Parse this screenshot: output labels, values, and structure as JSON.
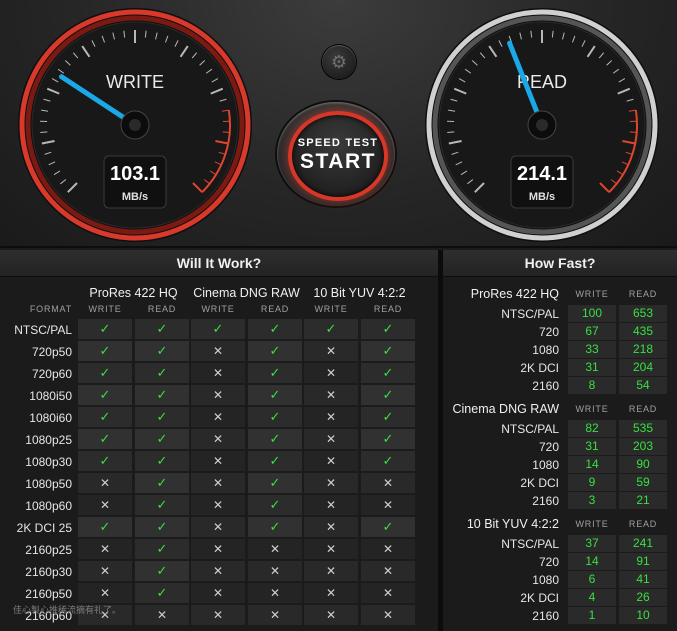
{
  "gauges": {
    "write": {
      "label": "WRITE",
      "value": "103.1",
      "unit": "MB/s",
      "needle_fraction": 0.29,
      "accent": "#d8392b"
    },
    "read": {
      "label": "READ",
      "value": "214.1",
      "unit": "MB/s",
      "needle_fraction": 0.42,
      "accent": "#c8c8c8"
    }
  },
  "settings_icon": "gear-icon",
  "start_button": {
    "line1": "SPEED TEST",
    "line2": "START"
  },
  "will_it_work": {
    "title": "Will It Work?",
    "format_label": "FORMAT",
    "groups": [
      {
        "name": "ProRes 422 HQ",
        "write": "WRITE",
        "read": "READ"
      },
      {
        "name": "Cinema DNG RAW",
        "write": "WRITE",
        "read": "READ"
      },
      {
        "name": "10 Bit YUV 4:2:2",
        "write": "WRITE",
        "read": "READ"
      }
    ],
    "rows": [
      {
        "format": "NTSC/PAL",
        "cells": [
          "✓",
          "✓",
          "✓",
          "✓",
          "✓",
          "✓"
        ]
      },
      {
        "format": "720p50",
        "cells": [
          "✓",
          "✓",
          "✕",
          "✓",
          "✕",
          "✓"
        ]
      },
      {
        "format": "720p60",
        "cells": [
          "✓",
          "✓",
          "✕",
          "✓",
          "✕",
          "✓"
        ]
      },
      {
        "format": "1080i50",
        "cells": [
          "✓",
          "✓",
          "✕",
          "✓",
          "✕",
          "✓"
        ]
      },
      {
        "format": "1080i60",
        "cells": [
          "✓",
          "✓",
          "✕",
          "✓",
          "✕",
          "✓"
        ]
      },
      {
        "format": "1080p25",
        "cells": [
          "✓",
          "✓",
          "✕",
          "✓",
          "✕",
          "✓"
        ]
      },
      {
        "format": "1080p30",
        "cells": [
          "✓",
          "✓",
          "✕",
          "✓",
          "✕",
          "✓"
        ]
      },
      {
        "format": "1080p50",
        "cells": [
          "✕",
          "✓",
          "✕",
          "✓",
          "✕",
          "✕"
        ]
      },
      {
        "format": "1080p60",
        "cells": [
          "✕",
          "✓",
          "✕",
          "✓",
          "✕",
          "✕"
        ]
      },
      {
        "format": "2K DCI 25",
        "cells": [
          "✓",
          "✓",
          "✕",
          "✓",
          "✕",
          "✓"
        ]
      },
      {
        "format": "2160p25",
        "cells": [
          "✕",
          "✓",
          "✕",
          "✕",
          "✕",
          "✕"
        ]
      },
      {
        "format": "2160p30",
        "cells": [
          "✕",
          "✓",
          "✕",
          "✕",
          "✕",
          "✕"
        ]
      },
      {
        "format": "2160p50",
        "cells": [
          "✕",
          "✓",
          "✕",
          "✕",
          "✕",
          "✕"
        ]
      },
      {
        "format": "2160p60",
        "cells": [
          "✕",
          "✕",
          "✕",
          "✕",
          "✕",
          "✕"
        ]
      }
    ]
  },
  "how_fast": {
    "title": "How Fast?",
    "sections": [
      {
        "name": "ProRes 422 HQ",
        "write": "WRITE",
        "read": "READ",
        "rows": [
          {
            "format": "NTSC/PAL",
            "write": "100",
            "read": "653"
          },
          {
            "format": "720",
            "write": "67",
            "read": "435"
          },
          {
            "format": "1080",
            "write": "33",
            "read": "218"
          },
          {
            "format": "2K DCI",
            "write": "31",
            "read": "204"
          },
          {
            "format": "2160",
            "write": "8",
            "read": "54"
          }
        ]
      },
      {
        "name": "Cinema DNG RAW",
        "write": "WRITE",
        "read": "READ",
        "rows": [
          {
            "format": "NTSC/PAL",
            "write": "82",
            "read": "535"
          },
          {
            "format": "720",
            "write": "31",
            "read": "203"
          },
          {
            "format": "1080",
            "write": "14",
            "read": "90"
          },
          {
            "format": "2K DCI",
            "write": "9",
            "read": "59"
          },
          {
            "format": "2160",
            "write": "3",
            "read": "21"
          }
        ]
      },
      {
        "name": "10 Bit YUV 4:2:2",
        "write": "WRITE",
        "read": "READ",
        "rows": [
          {
            "format": "NTSC/PAL",
            "write": "37",
            "read": "241"
          },
          {
            "format": "720",
            "write": "14",
            "read": "91"
          },
          {
            "format": "1080",
            "write": "6",
            "read": "41"
          },
          {
            "format": "2K DCI",
            "write": "4",
            "read": "26"
          },
          {
            "format": "2160",
            "write": "1",
            "read": "10"
          }
        ]
      }
    ]
  },
  "watermark": "佳心製心推稀流摘有礼了。",
  "colors": {
    "ok": "#38e03f",
    "write_ring": "#d8392b",
    "needle": "#1aa8e8"
  }
}
